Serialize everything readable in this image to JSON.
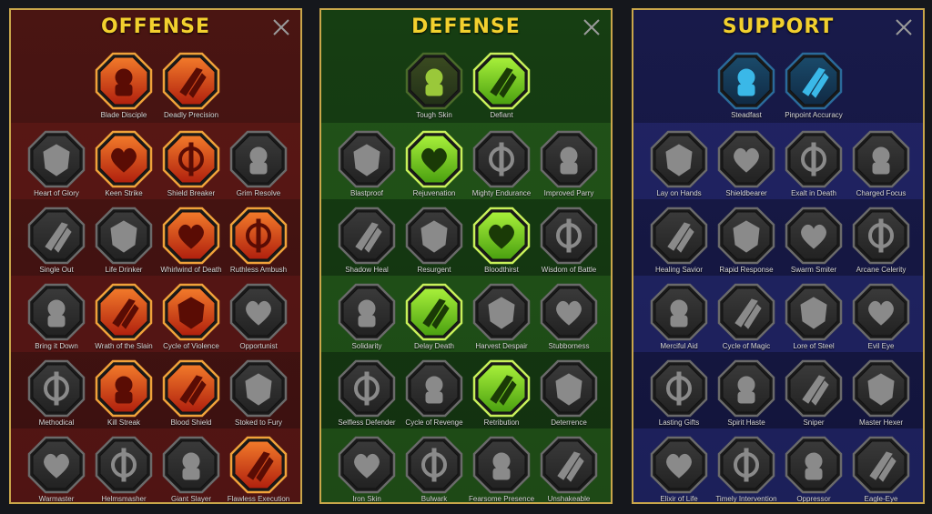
{
  "colors": {
    "offense_active": "#e8502a",
    "defense_active": "#8fe32a",
    "support_active": "#2aa8d8",
    "inactive": "#3a3a3a",
    "gold": "#c9a64a",
    "title": "#f2d02e"
  },
  "panels": [
    {
      "key": "offense",
      "title": "OFFENSE",
      "skills": [
        {
          "name": "Blade Disciple",
          "icon": "crossed-swords-icon",
          "active": false,
          "theme": "offense"
        },
        {
          "name": "Deadly Precision",
          "icon": "piercing-slash-icon",
          "active": true,
          "theme": "offense"
        },
        {
          "name": "Heart of Glory",
          "icon": "horned-warrior-icon",
          "active": false
        },
        {
          "name": "Keen Strike",
          "icon": "spear-strike-icon",
          "active": true,
          "theme": "offense"
        },
        {
          "name": "Shield Breaker",
          "icon": "broken-shield-icon",
          "active": true,
          "theme": "offense"
        },
        {
          "name": "Grim Resolve",
          "icon": "heart-dagger-icon",
          "active": false
        },
        {
          "name": "Single Out",
          "icon": "pointing-fighter-icon",
          "active": false
        },
        {
          "name": "Life Drinker",
          "icon": "fanged-mouth-icon",
          "active": false
        },
        {
          "name": "Whirlwind of Death",
          "icon": "skull-whirlwind-icon",
          "active": true,
          "theme": "offense"
        },
        {
          "name": "Ruthless Ambush",
          "icon": "dagger-hand-icon",
          "active": true,
          "theme": "offense"
        },
        {
          "name": "Bring it Down",
          "icon": "sword-heart-icon",
          "active": false
        },
        {
          "name": "Wrath of the Slain",
          "icon": "fist-hammer-icon",
          "active": true,
          "theme": "offense"
        },
        {
          "name": "Cycle of Violence",
          "icon": "axe-cycle-icon",
          "active": true,
          "theme": "offense"
        },
        {
          "name": "Opportunist",
          "icon": "chained-lightning-icon",
          "active": false
        },
        {
          "name": "Methodical",
          "icon": "blade-fan-icon",
          "active": false
        },
        {
          "name": "Kill Streak",
          "icon": "triple-skull-icon",
          "active": true,
          "theme": "offense"
        },
        {
          "name": "Blood Shield",
          "icon": "sword-orbit-icon",
          "active": true,
          "theme": "offense"
        },
        {
          "name": "Stoked to Fury",
          "icon": "raging-figure-icon",
          "active": false
        },
        {
          "name": "Warmaster",
          "icon": "sparkling-sword-icon",
          "active": false
        },
        {
          "name": "Helmsmasher",
          "icon": "knight-helm-icon",
          "active": false
        },
        {
          "name": "Giant Slayer",
          "icon": "giant-demon-icon",
          "active": false
        },
        {
          "name": "Flawless Execution",
          "icon": "flaming-skull-icon",
          "active": true,
          "theme": "offense"
        }
      ]
    },
    {
      "key": "defense",
      "title": "DEFENSE",
      "skills": [
        {
          "name": "Tough Skin",
          "icon": "scale-armor-icon",
          "active": false,
          "theme": "defense-dim"
        },
        {
          "name": "Defiant",
          "icon": "raised-fist-icon",
          "active": true,
          "theme": "defense"
        },
        {
          "name": "Blastproof",
          "icon": "layered-shield-icon",
          "active": false
        },
        {
          "name": "Rejuvenation",
          "icon": "heart-potion-icon",
          "active": true,
          "theme": "defense"
        },
        {
          "name": "Mighty Endurance",
          "icon": "stone-golem-icon",
          "active": false
        },
        {
          "name": "Improved Parry",
          "icon": "crossed-blades-icon",
          "active": false
        },
        {
          "name": "Shadow Heal",
          "icon": "wounded-figure-icon",
          "active": false
        },
        {
          "name": "Resurgent",
          "icon": "armored-knight-icon",
          "active": false
        },
        {
          "name": "Bloodthirst",
          "icon": "skull-heart-icon",
          "active": true,
          "theme": "defense"
        },
        {
          "name": "Wisdom of Battle",
          "icon": "meditating-figure-icon",
          "active": false
        },
        {
          "name": "Solidarity",
          "icon": "crowd-icon",
          "active": false
        },
        {
          "name": "Delay Death",
          "icon": "skull-hourglass-icon",
          "active": true,
          "theme": "defense"
        },
        {
          "name": "Harvest Despair",
          "icon": "open-hand-icon",
          "active": false
        },
        {
          "name": "Stubborness",
          "icon": "bull-head-icon",
          "active": false
        },
        {
          "name": "Selfless Defender",
          "icon": "shield-dash-icon",
          "active": false
        },
        {
          "name": "Cycle of Revenge",
          "icon": "triple-drop-icon",
          "active": false
        },
        {
          "name": "Retribution",
          "icon": "radiant-skull-icon",
          "active": true,
          "theme": "defense"
        },
        {
          "name": "Deterrence",
          "icon": "deflect-sword-icon",
          "active": false
        },
        {
          "name": "Iron Skin",
          "icon": "iron-warrior-icon",
          "active": false
        },
        {
          "name": "Bulwark",
          "icon": "tower-shield-icon",
          "active": false
        },
        {
          "name": "Fearsome Presence",
          "icon": "hooded-skull-icon",
          "active": false
        },
        {
          "name": "Unshakeable",
          "icon": "flexing-figure-icon",
          "active": false
        }
      ]
    },
    {
      "key": "support",
      "title": "SUPPORT",
      "skills": [
        {
          "name": "Steadfast",
          "icon": "sparkling-heart-icon",
          "active": false,
          "theme": "support-dim"
        },
        {
          "name": "Pinpoint Accuracy",
          "icon": "target-arrow-icon",
          "active": false,
          "theme": "support-dim"
        },
        {
          "name": "Lay on Hands",
          "icon": "praying-hands-icon",
          "active": false
        },
        {
          "name": "Shieldbearer",
          "icon": "radiant-shield-icon",
          "active": false
        },
        {
          "name": "Exalt in Death",
          "icon": "skull-waves-icon",
          "active": false
        },
        {
          "name": "Charged Focus",
          "icon": "energy-hand-icon",
          "active": false
        },
        {
          "name": "Healing Savior",
          "icon": "healing-figure-icon",
          "active": false
        },
        {
          "name": "Rapid Response",
          "icon": "lightning-bolt-icon",
          "active": false
        },
        {
          "name": "Swarm Smiter",
          "icon": "zigzag-bolts-icon",
          "active": false
        },
        {
          "name": "Arcane Celerity",
          "icon": "running-figure-icon",
          "active": false
        },
        {
          "name": "Merciful Aid",
          "icon": "chained-heart-icon",
          "active": false
        },
        {
          "name": "Cycle of Magic",
          "icon": "magic-comet-icon",
          "active": false
        },
        {
          "name": "Lore of Steel",
          "icon": "open-book-icon",
          "active": false
        },
        {
          "name": "Evil Eye",
          "icon": "glaring-eyes-icon",
          "active": false
        },
        {
          "name": "Lasting Gifts",
          "icon": "compass-star-icon",
          "active": false
        },
        {
          "name": "Spirit Haste",
          "icon": "winged-boot-icon",
          "active": false
        },
        {
          "name": "Sniper",
          "icon": "crosshair-eye-icon",
          "active": false
        },
        {
          "name": "Master Hexer",
          "icon": "voodoo-doll-icon",
          "active": false
        },
        {
          "name": "Elixir of Life",
          "icon": "potion-flask-icon",
          "active": false
        },
        {
          "name": "Timely Intervention",
          "icon": "winged-skull-icon",
          "active": false
        },
        {
          "name": "Oppressor",
          "icon": "crushing-fist-icon",
          "active": false
        },
        {
          "name": "Eagle-Eye",
          "icon": "eagle-head-icon",
          "active": false
        }
      ]
    }
  ]
}
